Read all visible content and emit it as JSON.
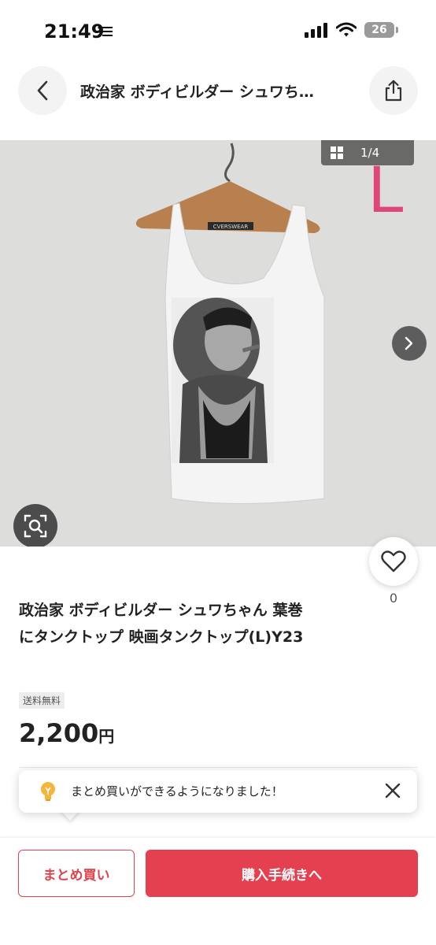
{
  "status_bar": {
    "time": "21:49",
    "battery": "26"
  },
  "header": {
    "title": "政治家 ボディビルダー シュワち…"
  },
  "image": {
    "counter": "1/4",
    "size_mark": "L",
    "tag_text": "CVERSWEAR"
  },
  "like": {
    "count": "0"
  },
  "product": {
    "title_line1": "政治家 ボディビルダー シュワちゃん 葉巻",
    "title_line2": "にタンクトップ 映画タンクトップ(L)Y23",
    "shipping_badge": "送料無料",
    "price": "2,200",
    "currency": "円"
  },
  "toast": {
    "message": "まとめ買いができるようになりました！"
  },
  "bottom_bar": {
    "bulk_label": "まとめ買い",
    "buy_label": "購入手続きへ"
  },
  "colors": {
    "accent": "#e5404f",
    "size_mark": "#e0457a"
  }
}
